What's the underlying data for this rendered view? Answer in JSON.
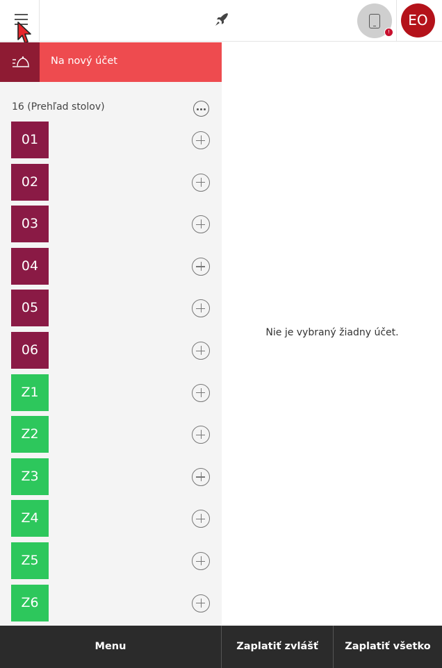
{
  "header": {
    "menu_icon": "hamburger-icon",
    "logo_icon": "rocket-logo-icon",
    "device_icon": "tablet-icon",
    "notification_badge": "!",
    "avatar_initials": "EO"
  },
  "sidebar": {
    "new_account_label": "Na nový účet",
    "new_account_icon": "serve-dish-icon",
    "overview_title": "16 (Prehľad stolov)",
    "tables": [
      {
        "label": "01",
        "color": "#8a1a45"
      },
      {
        "label": "02",
        "color": "#8a1a45"
      },
      {
        "label": "03",
        "color": "#8a1a45"
      },
      {
        "label": "04",
        "color": "#8a1a45"
      },
      {
        "label": "05",
        "color": "#8a1a45"
      },
      {
        "label": "06",
        "color": "#8a1a45"
      },
      {
        "label": "Z1",
        "color": "#2dc75c"
      },
      {
        "label": "Z2",
        "color": "#2dc75c"
      },
      {
        "label": "Z3",
        "color": "#2dc75c"
      },
      {
        "label": "Z4",
        "color": "#2dc75c"
      },
      {
        "label": "Z5",
        "color": "#2dc75c"
      },
      {
        "label": "Z6",
        "color": "#2dc75c"
      }
    ]
  },
  "main": {
    "empty_message": "Nie je vybraný žiadny účet."
  },
  "footer": {
    "menu_label": "Menu",
    "pay_separately_label": "Zaplatiť zvlášť",
    "pay_all_label": "Zaplatiť všetko"
  },
  "colors": {
    "accent_red": "#ee4b4f",
    "dark_wine": "#8e1b33",
    "avatar": "#b4121a",
    "footer": "#2b2b2b"
  }
}
